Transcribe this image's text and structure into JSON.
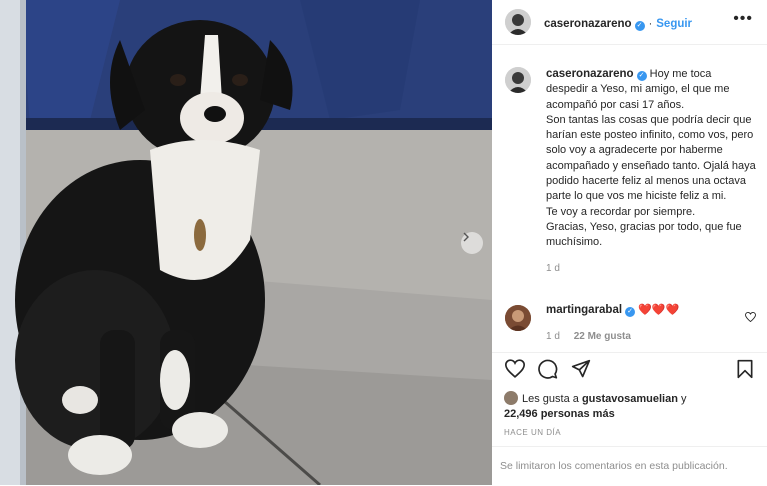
{
  "post": {
    "author": "caseronazareno",
    "follow_label": "Seguir",
    "more_label": "•••",
    "caption_lines": [
      "Hoy me toca despedir a Yeso, mi amigo, el que me acompañó por casi 17 años.",
      "Son tantas las cosas que podría decir que harían este posteo infinito, como vos, pero solo voy a agradecerte por haberme acompañado y enseñado tanto. Ojalá haya podido hacerte feliz al menos una octava parte lo que vos me hiciste feliz a mi.",
      "Te voy a recordar por siempre.",
      "Gracias, Yeso, gracias por todo, que fue muchísimo."
    ],
    "caption_time": "1 d"
  },
  "comment": {
    "author": "martingarabal",
    "text": "❤️❤️❤️",
    "time": "1 d",
    "likes": "22 Me gusta"
  },
  "likes": {
    "prefix": "Les gusta a ",
    "first_user": "gustavosamuelian",
    "connector": " y",
    "others": "22,496 personas más"
  },
  "posted_ago": "HACE UN DÍA",
  "comments_disabled": "Se limitaron los comentarios en esta publicación.",
  "icons": {
    "photo_next": "chevron-right-icon",
    "like": "heart-icon",
    "comment": "comment-bubble-icon",
    "share": "paper-plane-icon",
    "save": "bookmark-icon",
    "verified": "verified-badge-icon"
  },
  "colors": {
    "link_blue": "#3897f0",
    "muted": "#8e8e8e",
    "heart_red": "#ed4956",
    "text": "#262626"
  }
}
